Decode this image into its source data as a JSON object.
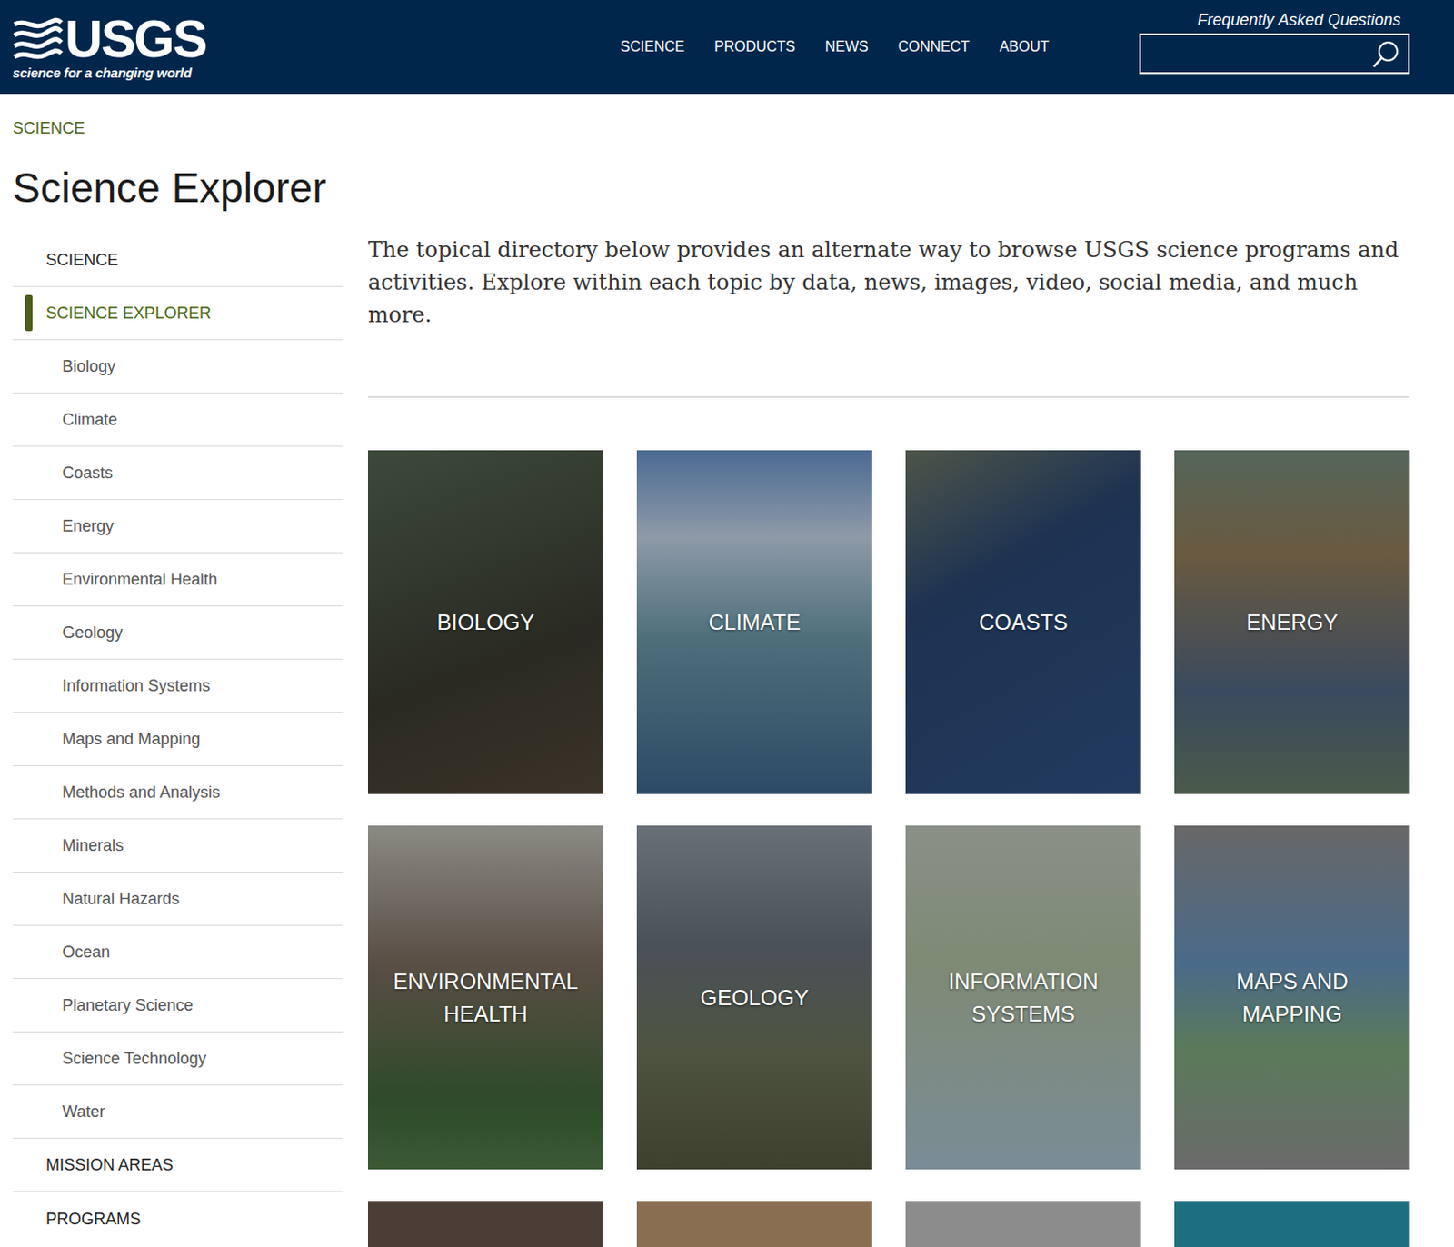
{
  "header": {
    "logo": {
      "wordmark": "USGS",
      "tagline": "science for a changing world"
    },
    "nav": [
      {
        "label": "SCIENCE"
      },
      {
        "label": "PRODUCTS"
      },
      {
        "label": "NEWS"
      },
      {
        "label": "CONNECT"
      },
      {
        "label": "ABOUT"
      }
    ],
    "faq_link": "Frequently Asked Questions"
  },
  "breadcrumb": [
    "SCIENCE"
  ],
  "page_title": "Science Explorer",
  "sidebar": {
    "items": [
      {
        "label": "SCIENCE",
        "kind": "section",
        "selected": false
      },
      {
        "label": "SCIENCE EXPLORER",
        "kind": "section",
        "selected": true
      },
      {
        "label": "Biology",
        "kind": "topic",
        "selected": false
      },
      {
        "label": "Climate",
        "kind": "topic",
        "selected": false
      },
      {
        "label": "Coasts",
        "kind": "topic",
        "selected": false
      },
      {
        "label": "Energy",
        "kind": "topic",
        "selected": false
      },
      {
        "label": "Environmental Health",
        "kind": "topic",
        "selected": false
      },
      {
        "label": "Geology",
        "kind": "topic",
        "selected": false
      },
      {
        "label": "Information Systems",
        "kind": "topic",
        "selected": false
      },
      {
        "label": "Maps and Mapping",
        "kind": "topic",
        "selected": false
      },
      {
        "label": "Methods and Analysis",
        "kind": "topic",
        "selected": false
      },
      {
        "label": "Minerals",
        "kind": "topic",
        "selected": false
      },
      {
        "label": "Natural Hazards",
        "kind": "topic",
        "selected": false
      },
      {
        "label": "Ocean",
        "kind": "topic",
        "selected": false
      },
      {
        "label": "Planetary Science",
        "kind": "topic",
        "selected": false
      },
      {
        "label": "Science Technology",
        "kind": "topic",
        "selected": false
      },
      {
        "label": "Water",
        "kind": "topic",
        "selected": false
      },
      {
        "label": "MISSION AREAS",
        "kind": "section",
        "selected": false
      },
      {
        "label": "PROGRAMS",
        "kind": "section",
        "selected": false
      }
    ]
  },
  "intro": "The topical directory below provides an alternate way to browse USGS science programs and activities. Explore within each topic by data, news, images, video, social media, and much more.",
  "tiles": [
    {
      "label": "BIOLOGY"
    },
    {
      "label": "CLIMATE"
    },
    {
      "label": "COASTS"
    },
    {
      "label": "ENERGY"
    },
    {
      "label": "ENVIRONMENTAL HEALTH"
    },
    {
      "label": "GEOLOGY"
    },
    {
      "label": "INFORMATION SYSTEMS"
    },
    {
      "label": "MAPS AND MAPPING"
    },
    {
      "label": ""
    },
    {
      "label": ""
    },
    {
      "label": ""
    },
    {
      "label": ""
    }
  ]
}
